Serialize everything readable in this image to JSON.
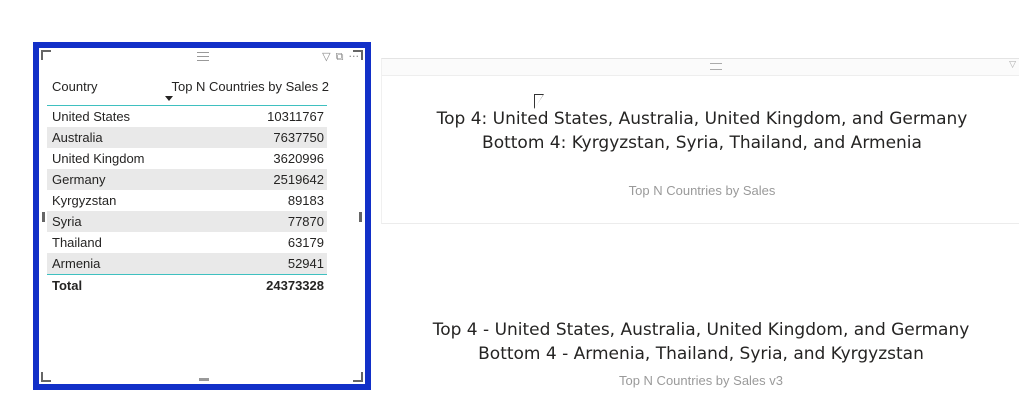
{
  "table_visual": {
    "headers": {
      "country": "Country",
      "sales": "Top N Countries by Sales 2"
    },
    "rows": [
      {
        "country": "United States",
        "value": "10311767"
      },
      {
        "country": "Australia",
        "value": "7637750"
      },
      {
        "country": "United Kingdom",
        "value": "3620996"
      },
      {
        "country": "Germany",
        "value": "2519642"
      },
      {
        "country": "Kyrgyzstan",
        "value": "89183"
      },
      {
        "country": "Syria",
        "value": "77870"
      },
      {
        "country": "Thailand",
        "value": "63179"
      },
      {
        "country": "Armenia",
        "value": "52941"
      }
    ],
    "total": {
      "label": "Total",
      "value": "24373328"
    },
    "icons": [
      "filter-icon",
      "focus-mode-icon",
      "more-options-icon"
    ],
    "border_color": "#1230c8"
  },
  "card1": {
    "line1": "Top 4: United States, Australia, United Kingdom, and Germany",
    "line2": "Bottom 4: Kyrgyzstan, Syria, Thailand, and Armenia",
    "subtitle": "Top N Countries by Sales"
  },
  "card2": {
    "line1": "Top 4 - United States, Australia, United Kingdom, and Germany",
    "line2": "Bottom 4 - Armenia, Thailand, Syria, and Kyrgyzstan",
    "subtitle": "Top N Countries by Sales v3"
  }
}
